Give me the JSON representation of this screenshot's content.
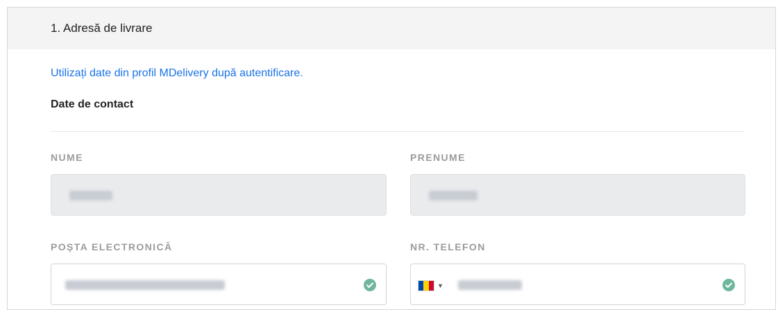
{
  "section": {
    "title": "1. Adresă de livrare",
    "login_link": "Utilizați date din profil MDelivery după autentificare.",
    "contact_title": "Date de contact"
  },
  "fields": {
    "nume": {
      "label": "NUME"
    },
    "prenume": {
      "label": "PRENUME"
    },
    "email": {
      "label": "POȘTA ELECTRONICĂ"
    },
    "phone": {
      "label": "NR. TELEFON"
    }
  },
  "colors": {
    "link": "#1a73e8",
    "success": "#6fb79c",
    "label": "#9b9b9b",
    "disabled_bg": "#e9ebed"
  },
  "icons": {
    "valid": "check-circle-icon",
    "flag": "moldova-flag-icon",
    "dropdown": "caret-down-icon"
  }
}
